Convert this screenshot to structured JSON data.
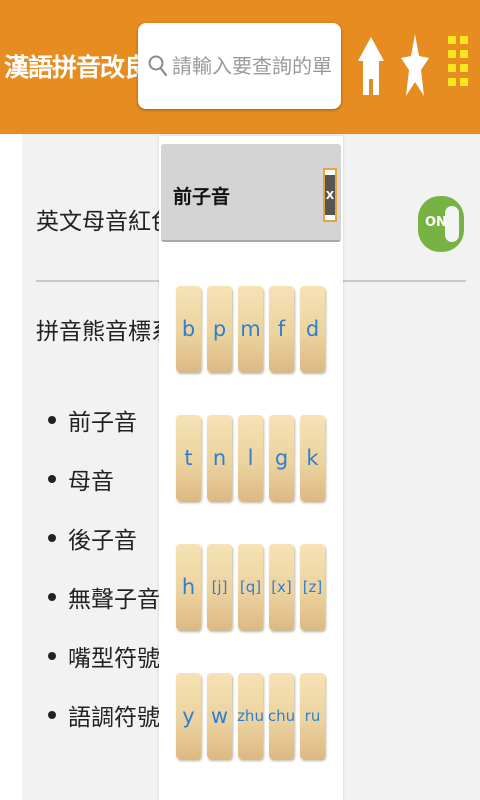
{
  "header": {
    "app_title": "漢語拼音改良版",
    "dropdown_icon": "chevron-down-icon",
    "search_placeholder": "請輸入要查詢的單字",
    "search_value": "",
    "icons": [
      "search-icon",
      "home-icon",
      "star-icon",
      "menu-grid-icon"
    ]
  },
  "settings": {
    "vowel_red_label": "英文母音紅色顯示",
    "vowel_red_toggle": "ON",
    "phonetic_label": "拼音熊音標系統",
    "categories": [
      "前子音",
      "母音",
      "後子音",
      "無聲子音",
      "嘴型符號",
      "語調符號"
    ]
  },
  "popup": {
    "title": "前子音",
    "close_label": "X",
    "rows": [
      [
        "b",
        "p",
        "m",
        "f",
        "d"
      ],
      [
        "t",
        "n",
        "l",
        "g",
        "k"
      ],
      [
        "h",
        "[j]",
        "[q]",
        "[x]",
        "[z]"
      ],
      [
        "y",
        "w",
        "zhu",
        "chu",
        "ru"
      ]
    ]
  },
  "colors": {
    "topbar": "#e78c21",
    "toggle_on": "#78b243",
    "tile_text": "#2f7fd1",
    "panel_bg": "#f2f2f2"
  }
}
